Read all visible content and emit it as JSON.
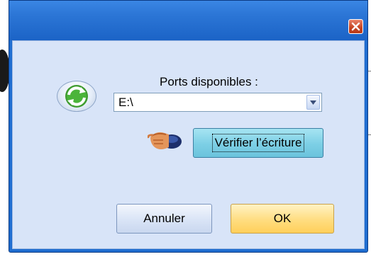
{
  "dialog": {
    "close_icon": "close-icon",
    "ports_label": "Ports disponibles :",
    "port_value": "E:\\",
    "refresh_icon": "refresh-icon",
    "pointing_hand_icon": "pointing-hand-icon",
    "verify_label": "Vérifier l’écriture",
    "cancel_label": "Annuler",
    "ok_label": "OK"
  },
  "colors": {
    "titlebar": "#2c76d6",
    "client_bg": "#d8e4f8",
    "verify_bg": "#7ccfe5",
    "ok_bg": "#ffdd80",
    "close_bg": "#c5431f"
  }
}
